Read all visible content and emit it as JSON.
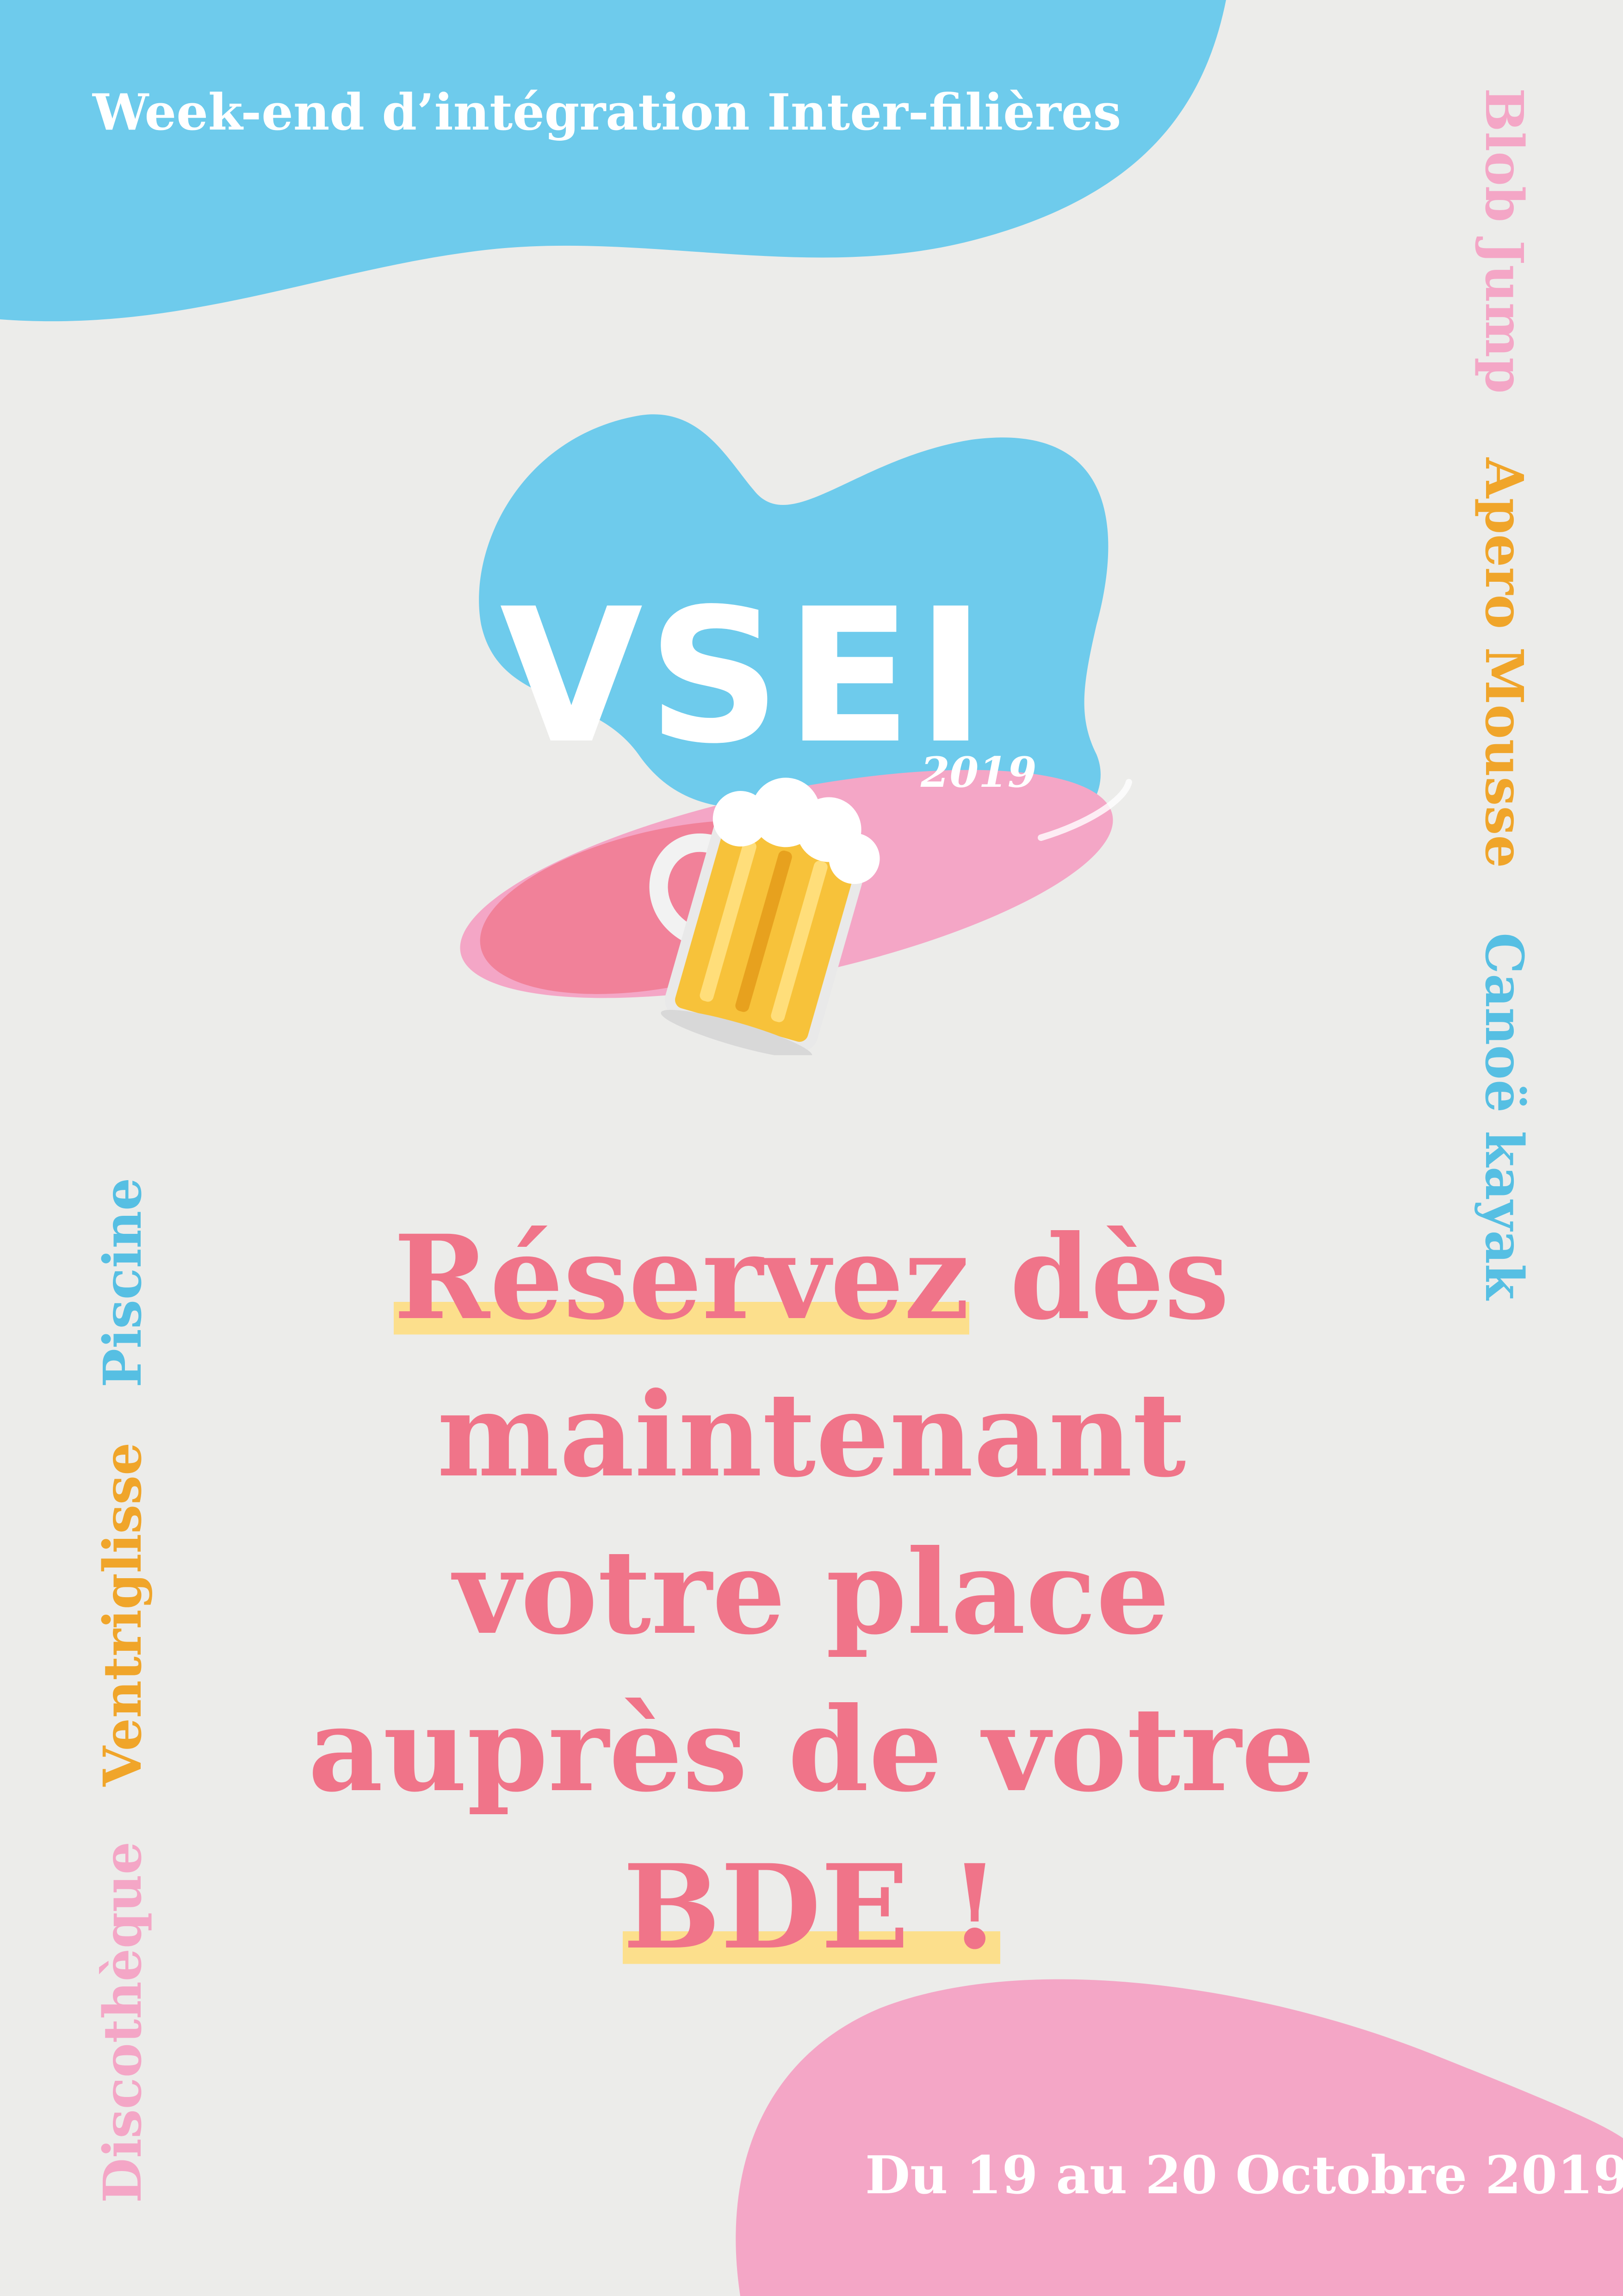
{
  "header": {
    "title": "Week-end d’intégration Inter-filières"
  },
  "logo": {
    "letters": "VSEI",
    "year": "2019"
  },
  "activities_right": [
    "Blob Jump",
    "Apero Mousse",
    "Canoë kayak"
  ],
  "activities_left": [
    "Discothèque",
    "Ventriglisse",
    "Piscine"
  ],
  "headline": {
    "part1": "Réservez",
    "part2": " dès maintenant votre place auprès de votre ",
    "part3": "BDE !"
  },
  "footer": {
    "date": "Du 19 au 20 Octobre 2019"
  },
  "colors": {
    "background": "#ececea",
    "blue": "#6ecbec",
    "pink": "#f4a6c6",
    "coral": "#f07489",
    "orange": "#f0a52a",
    "highlight": "#fcdf8c"
  }
}
